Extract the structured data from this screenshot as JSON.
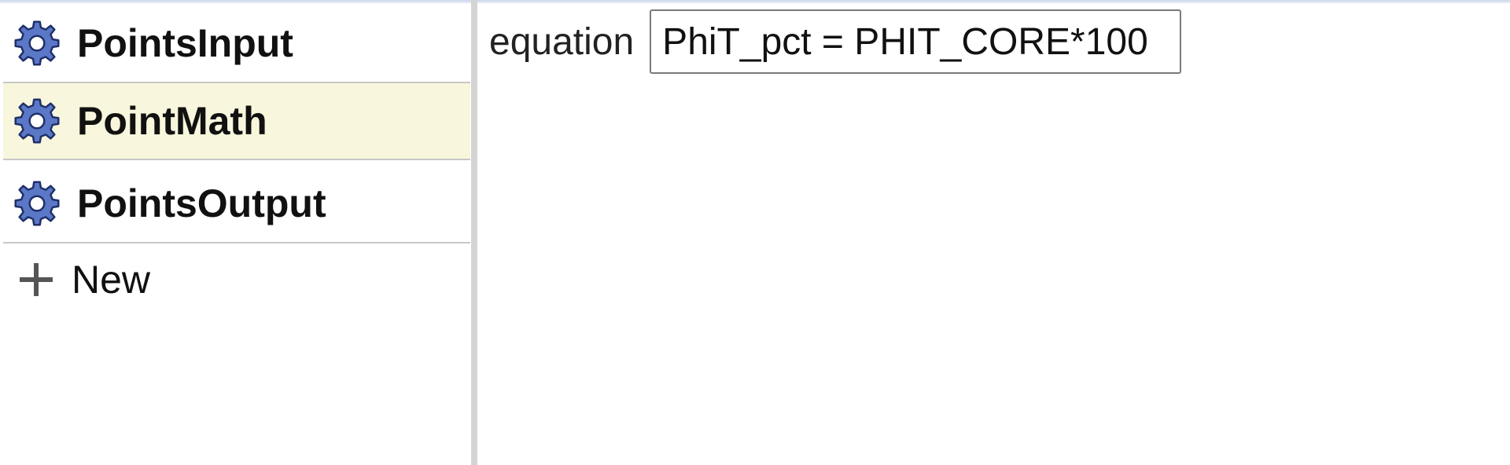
{
  "sidebar": {
    "items": [
      {
        "label": "PointsInput",
        "icon": "gear-icon",
        "selected": false
      },
      {
        "label": "PointMath",
        "icon": "gear-icon",
        "selected": true
      },
      {
        "label": "PointsOutput",
        "icon": "gear-icon",
        "selected": false
      }
    ],
    "new_label": "New",
    "new_icon": "plus-icon"
  },
  "main": {
    "equation_label": "equation",
    "equation_value": "PhiT_pct = PHIT_CORE*100"
  },
  "colors": {
    "selected_background": "#f8f6dc",
    "gear_fill": "#5b78c6",
    "splitter": "#d4d4d4"
  }
}
